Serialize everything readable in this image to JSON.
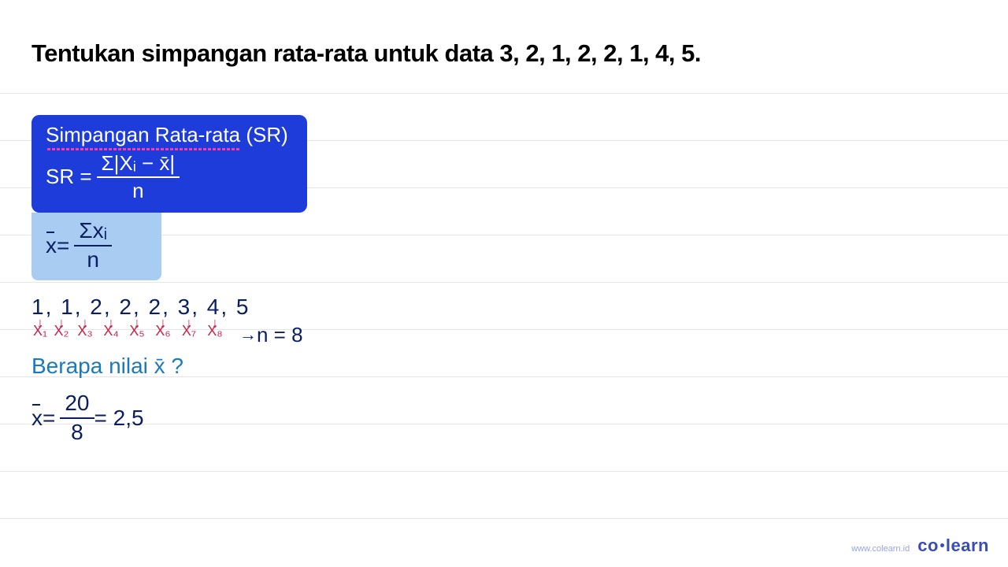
{
  "title": "Tentukan simpangan rata-rata untuk data 3, 2, 1, 2, 2, 1, 4, 5.",
  "formula_box": {
    "heading_underlined": "Simpangan Rata-rata",
    "heading_suffix": " (SR)",
    "lhs": "SR =",
    "num": "Σ|Xᵢ − x̄|",
    "den": "n"
  },
  "mean_box": {
    "lhs_var": "x",
    "eq": " = ",
    "num": "Σxᵢ",
    "den": "n"
  },
  "dataset_sorted": "1, 1, 2, 2, 2, 3, 4, 5",
  "data_labels": [
    "X₁",
    "X₂",
    "X₃",
    "X₄",
    "X₅",
    "X₆",
    "X₇",
    "X₈"
  ],
  "arrow_glyph": "↓",
  "n_arrow": "→",
  "n_equation": "n = 8",
  "question_line": "Berapa nilai x̄ ?",
  "mean_calc": {
    "lhs_var": "x",
    "eq": " = ",
    "num": "20",
    "den": "8",
    "result": " = 2,5"
  },
  "footer": {
    "url": "www.colearn.id",
    "brand_co": "co",
    "brand_learn": "learn"
  },
  "chart_data": {
    "type": "table",
    "title": "Sorted data and mean",
    "categories": [
      "X1",
      "X2",
      "X3",
      "X4",
      "X5",
      "X6",
      "X7",
      "X8"
    ],
    "values": [
      1,
      1,
      2,
      2,
      2,
      3,
      4,
      5
    ],
    "n": 8,
    "sum": 20,
    "mean": 2.5
  }
}
